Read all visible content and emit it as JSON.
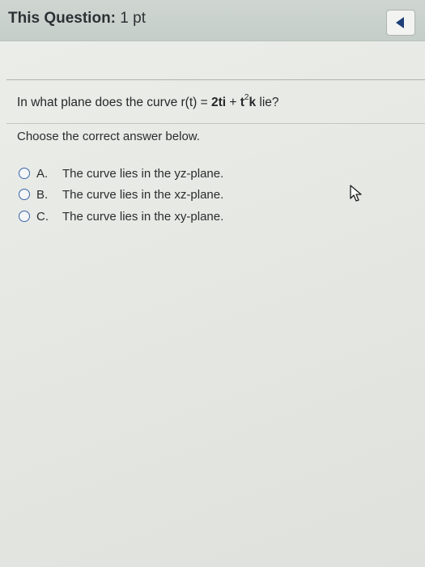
{
  "header": {
    "title_label": "This Question:",
    "title_points": "1 pt",
    "back_icon": "left-triangle-icon"
  },
  "question": {
    "prefix": "In what plane does the curve r(t) = ",
    "term1": "2ti",
    "plus": " + ",
    "term2_base": "t",
    "term2_exp": "2",
    "term2_vec": "k",
    "suffix": " lie?"
  },
  "instruction": "Choose the correct answer below.",
  "options": [
    {
      "letter": "A.",
      "text": "The curve lies in the yz-plane."
    },
    {
      "letter": "B.",
      "text": "The curve lies in the xz-plane."
    },
    {
      "letter": "C.",
      "text": "The curve lies in the xy-plane."
    }
  ],
  "colors": {
    "header_bg": "#c8d0cb",
    "radio_border": "#3a67a8",
    "back_arrow": "#1f3f78"
  }
}
